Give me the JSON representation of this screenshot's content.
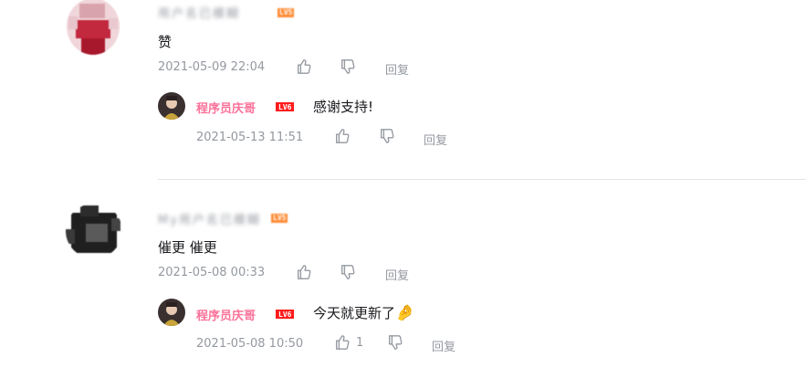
{
  "comments": [
    {
      "user": "用户名已模糊",
      "level": "LV5",
      "text": "赞",
      "time": "2021-05-09 22:04",
      "reply_label": "回复",
      "reply": {
        "user": "程序员庆哥",
        "level": "LV6",
        "text": "感谢支持!",
        "time": "2021-05-13 11:51",
        "reply_label": "回复",
        "like_count": ""
      }
    },
    {
      "user": "My用户名已模糊",
      "level": "LV5",
      "text": "催更 催更",
      "time": "2021-05-08 00:33",
      "reply_label": "回复",
      "reply": {
        "user": "程序员庆哥",
        "level": "LV6",
        "text": "今天就更新了",
        "emoji": "🤌",
        "time": "2021-05-08 10:50",
        "reply_label": "回复",
        "like_count": "1"
      }
    }
  ],
  "colors": {
    "up_name": "#fb7299",
    "meta": "#9499a0",
    "text": "#18191c",
    "divider": "#e3e5e7",
    "level_red": "#ff1a1a",
    "level_orange": "#ff8a33"
  }
}
